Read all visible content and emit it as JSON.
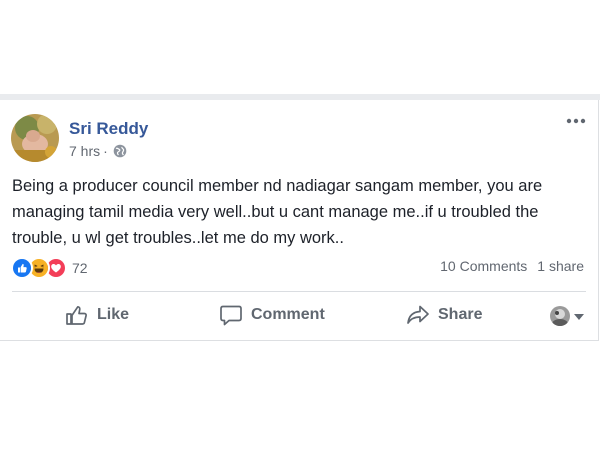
{
  "post": {
    "author": "Sri Reddy",
    "time": "7 hrs",
    "separator": "·",
    "audience_icon": "globe-icon",
    "more_icon": "more-options-icon",
    "text": "Being a producer council member nd nadiagar sangam member, you are managing tamil media very well..but u cant manage me..if u troubled the trouble, u wl get troubles..let me do my work..",
    "reactions": {
      "types": [
        "like",
        "haha",
        "love"
      ],
      "count": "72"
    },
    "comments": "10 Comments",
    "shares": "1 share",
    "actions": {
      "like": "Like",
      "comment": "Comment",
      "share": "Share"
    }
  },
  "colors": {
    "author": "#365899",
    "like_blue": "#1877f2",
    "haha_yellow": "#f7b125",
    "love_red": "#f33e58",
    "muted": "#616770"
  }
}
